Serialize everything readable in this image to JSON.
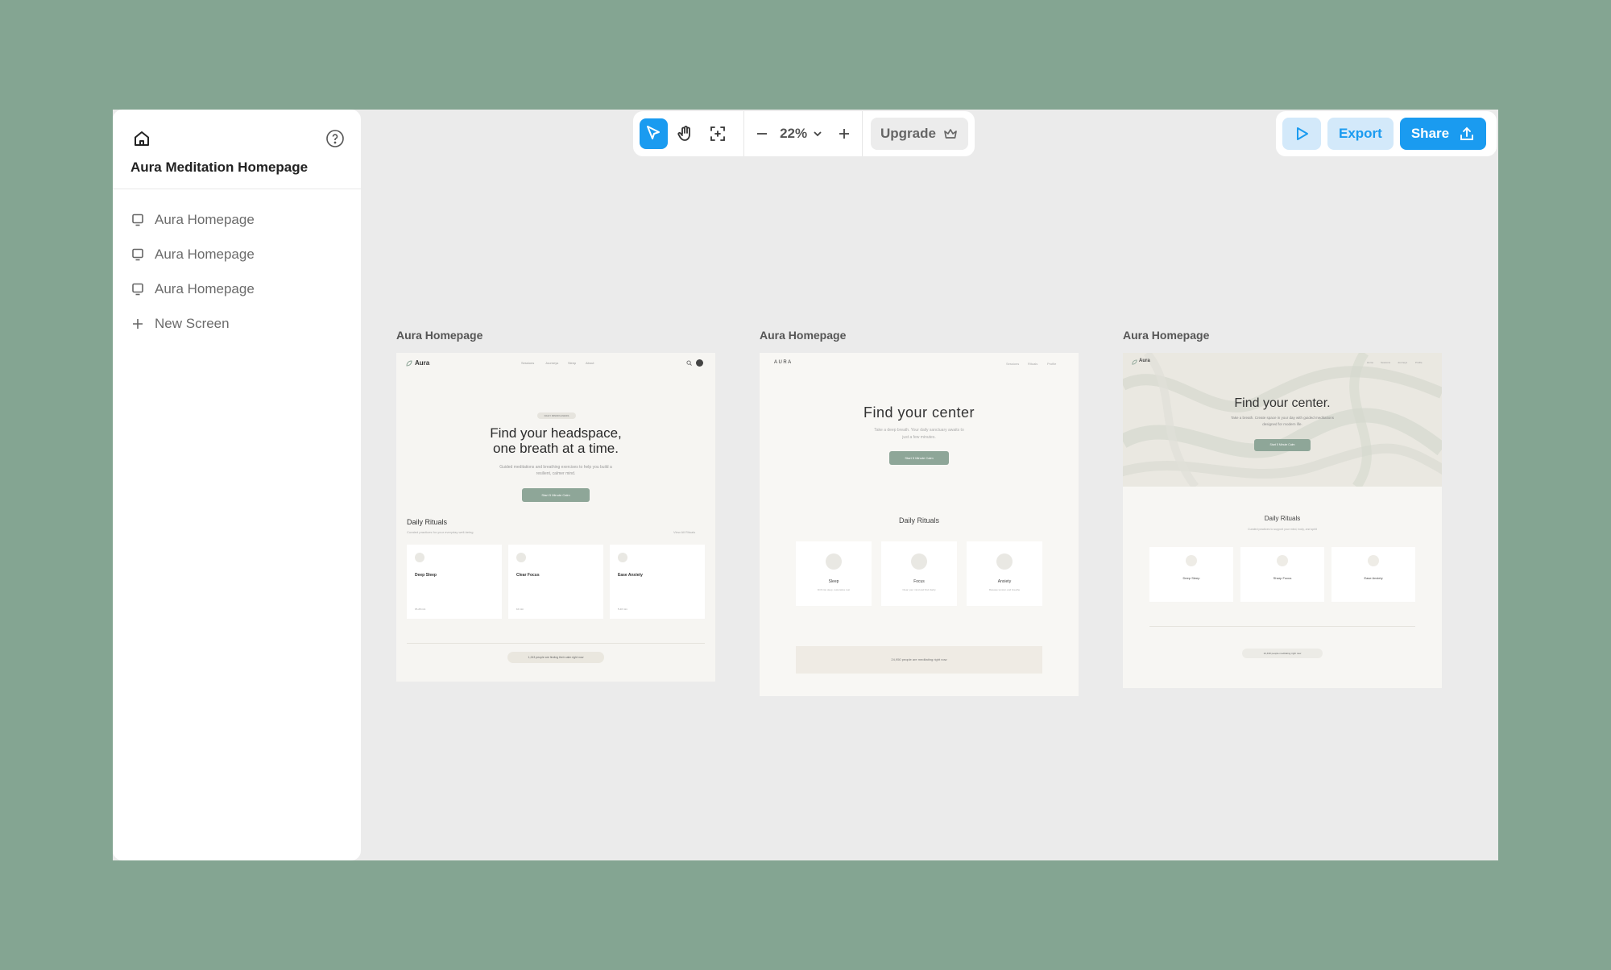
{
  "project": {
    "title": "Aura Meditation Homepage"
  },
  "sidebar": {
    "items": [
      {
        "label": "Aura Homepage"
      },
      {
        "label": "Aura Homepage"
      },
      {
        "label": "Aura Homepage"
      }
    ],
    "new_screen": "New Screen"
  },
  "toolbar": {
    "zoom": "22%",
    "upgrade": "Upgrade"
  },
  "right_toolbar": {
    "export": "Export",
    "share": "Share"
  },
  "colors": {
    "accent": "#1a9bf0",
    "canvas": "#ebebeb",
    "background": "#84a592",
    "aura_green": "#8ea698"
  },
  "screens": [
    {
      "label": "Aura Homepage",
      "logo": "Aura",
      "nav": [
        "Sessions",
        "Journeys",
        "Sleep",
        "About"
      ],
      "badge": "DAILY MINDFULNESS",
      "hero_line1": "Find your headspace,",
      "hero_line2": "one breath at a time.",
      "sub1": "Guided meditations and breathing exercises to help you build a",
      "sub2": "resilient, calmer mind.",
      "cta": "Start 5 Minute Calm",
      "section_title": "Daily Rituals",
      "section_sub": "Curated practices for your everyday well-being",
      "view_all": "View All Rituals",
      "cards": [
        {
          "title": "Deep Sleep",
          "meta": "15-20 min"
        },
        {
          "title": "Clear Focus",
          "meta": "10 min"
        },
        {
          "title": "Ease Anxiety",
          "meta": "5-10 min"
        }
      ],
      "footer_pill": "1,243 people are finding their calm right now"
    },
    {
      "label": "Aura Homepage",
      "logo": "AURA",
      "nav": [
        "Sessions",
        "Rituals",
        "Profile"
      ],
      "hero": "Find your center",
      "sub1": "Take a deep breath. Your daily sanctuary awaits to",
      "sub2": "just a few minutes.",
      "cta": "Start 5 Minute Calm",
      "section_title": "Daily Rituals",
      "cards": [
        {
          "title": "Sleep",
          "desc": "Drift into deep, restorative rest"
        },
        {
          "title": "Focus",
          "desc": "Clear your mind and find clarity"
        },
        {
          "title": "Anxiety",
          "desc": "Release tension and breathe"
        }
      ],
      "footer": "24,950 people are meditating right now"
    },
    {
      "label": "Aura Homepage",
      "logo": "Aura",
      "nav": [
        "Home",
        "Sessions",
        "Journeys",
        "Profile"
      ],
      "hero": "Find your center.",
      "sub1": "Take a breath. Create space in your day with guided meditations",
      "sub2": "designed for modern life.",
      "cta": "Start 5 Minute Calm",
      "section_title": "Daily Rituals",
      "section_sub": "Curated practices to support your mind, body, and spirit",
      "cards": [
        {
          "title": "Deep Sleep"
        },
        {
          "title": "Sharp Focus"
        },
        {
          "title": "Ease Anxiety"
        }
      ],
      "footer_pill": "12,430 people meditating right now"
    }
  ]
}
